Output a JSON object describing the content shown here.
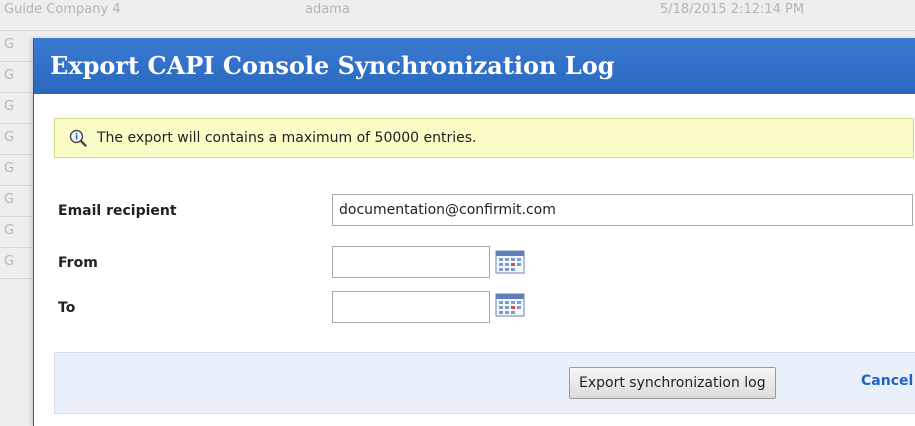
{
  "background_rows": [
    {
      "col1": "Guide Company 4",
      "col2": "adama",
      "col3": "5/18/2015 2:12:14 PM"
    },
    {
      "col1": "G",
      "col2": "",
      "col3": ""
    },
    {
      "col1": "G",
      "col2": "",
      "col3": ""
    },
    {
      "col1": "G",
      "col2": "",
      "col3": ""
    },
    {
      "col1": "G",
      "col2": "",
      "col3": ""
    },
    {
      "col1": "G",
      "col2": "",
      "col3": ""
    },
    {
      "col1": "G",
      "col2": "",
      "col3": ""
    },
    {
      "col1": "G",
      "col2": "",
      "col3": ""
    },
    {
      "col1": "G",
      "col2": "",
      "col3": ""
    }
  ],
  "dialog": {
    "title": "Export CAPI Console Synchronization Log",
    "notice": {
      "icon": "magnifier-info-icon",
      "text": "The export will contains a maximum of 50000 entries."
    },
    "fields": {
      "email_label": "Email recipient",
      "email_value": "documentation@confirmit.com",
      "from_label": "From",
      "from_value": "",
      "to_label": "To",
      "to_value": "",
      "calendar_icon": "calendar-icon"
    },
    "footer": {
      "export_label": "Export synchronization log",
      "cancel_label": "Cancel"
    }
  },
  "colors": {
    "header": "#2f6fc6",
    "notice_bg": "#fbfbc8",
    "footer_bg": "#eaf0fa",
    "link": "#1e63c4"
  }
}
